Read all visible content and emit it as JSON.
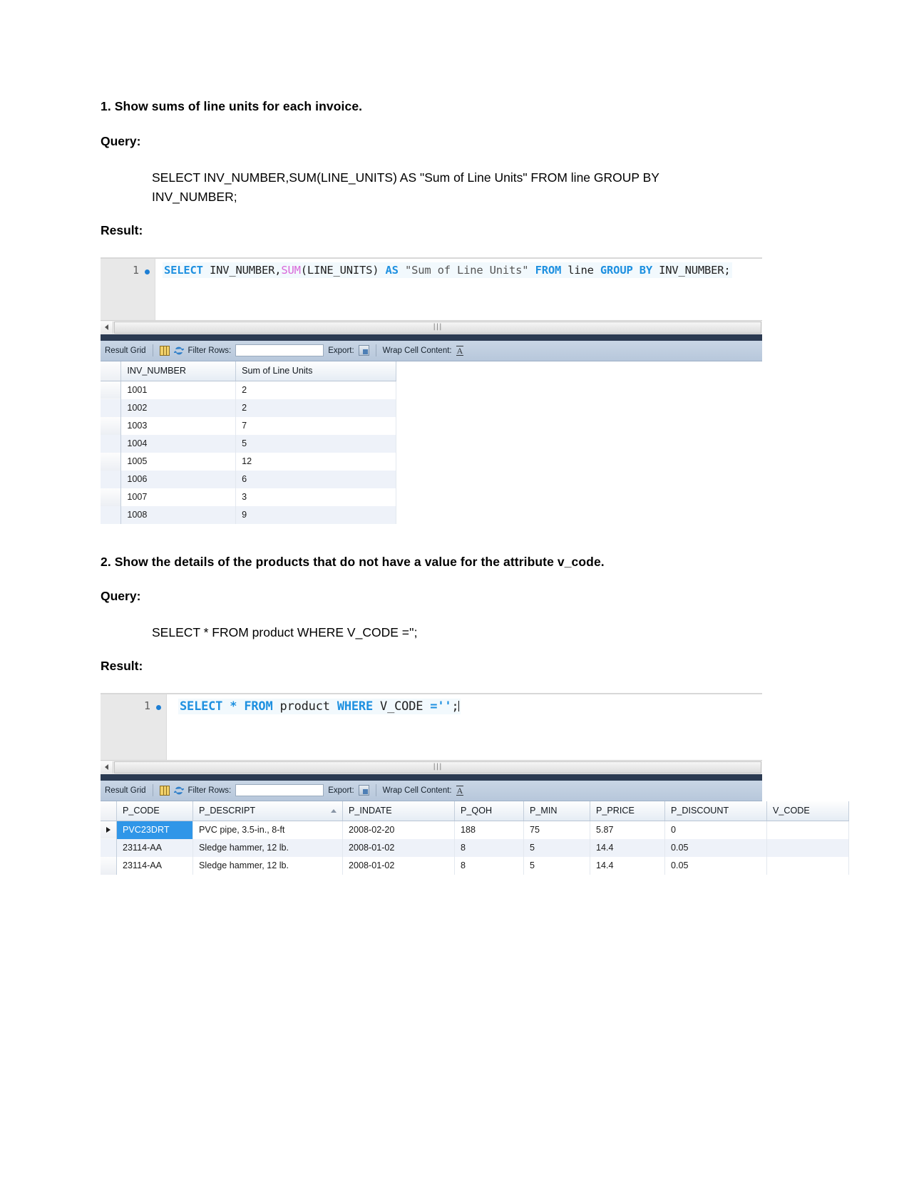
{
  "document": {
    "sections": [
      {
        "heading": "1. Show sums of line units for each invoice.",
        "query_label": "Query:",
        "query_text": "SELECT INV_NUMBER,SUM(LINE_UNITS) AS \"Sum of Line Units\" FROM line GROUP BY INV_NUMBER;",
        "result_label": "Result:"
      },
      {
        "heading": "2. Show the details of the products that do not have a value for the attribute v_code.",
        "query_label": "Query:",
        "query_text": "SELECT * FROM product WHERE V_CODE ='';",
        "result_label": "Result:"
      }
    ]
  },
  "workbench1": {
    "editor": {
      "line_number": "1",
      "tokens": [
        {
          "t": "SELECT",
          "c": "kw"
        },
        {
          "t": " ",
          "c": "id"
        },
        {
          "t": "INV_NUMBER,",
          "c": "id"
        },
        {
          "t": "SUM",
          "c": "fn"
        },
        {
          "t": "(LINE_UNITS)",
          "c": "id"
        },
        {
          "t": " ",
          "c": "id"
        },
        {
          "t": "AS",
          "c": "kw"
        },
        {
          "t": " ",
          "c": "id"
        },
        {
          "t": "\"Sum of Line Units\"",
          "c": "str"
        },
        {
          "t": " ",
          "c": "id"
        },
        {
          "t": "FROM",
          "c": "kw"
        },
        {
          "t": " line ",
          "c": "id"
        },
        {
          "t": "GROUP BY",
          "c": "kw"
        },
        {
          "t": " INV_NUMBER;",
          "c": "id"
        }
      ]
    },
    "toolbar": {
      "result_grid_label": "Result Grid",
      "filter_rows_label": "Filter Rows:",
      "filter_rows_value": "",
      "export_label": "Export:",
      "wrap_cell_content_label": "Wrap Cell Content:",
      "wrap_icon_glyph": "A"
    },
    "grid": {
      "columns": [
        "INV_NUMBER",
        "Sum of Line Units"
      ],
      "rows": [
        [
          "1001",
          "2"
        ],
        [
          "1002",
          "2"
        ],
        [
          "1003",
          "7"
        ],
        [
          "1004",
          "5"
        ],
        [
          "1005",
          "12"
        ],
        [
          "1006",
          "6"
        ],
        [
          "1007",
          "3"
        ],
        [
          "1008",
          "9"
        ]
      ]
    }
  },
  "workbench2": {
    "editor": {
      "line_number": "1",
      "tokens": [
        {
          "t": "SELECT",
          "c": "kw"
        },
        {
          "t": " ",
          "c": "id"
        },
        {
          "t": "*",
          "c": "kw"
        },
        {
          "t": " ",
          "c": "id"
        },
        {
          "t": "FROM",
          "c": "kw"
        },
        {
          "t": " product ",
          "c": "id"
        },
        {
          "t": "WHERE",
          "c": "kw"
        },
        {
          "t": " V_CODE ",
          "c": "id"
        },
        {
          "t": "=''",
          "c": "kw"
        },
        {
          "t": ";",
          "c": "id"
        }
      ]
    },
    "toolbar": {
      "result_grid_label": "Result Grid",
      "filter_rows_label": "Filter Rows:",
      "filter_rows_value": "",
      "export_label": "Export:",
      "wrap_cell_content_label": "Wrap Cell Content:",
      "wrap_icon_glyph": "A"
    },
    "grid": {
      "columns": [
        "P_CODE",
        "P_DESCRIPT",
        "P_INDATE",
        "P_QOH",
        "P_MIN",
        "P_PRICE",
        "P_DISCOUNT",
        "V_CODE"
      ],
      "sorted_column": "P_DESCRIPT",
      "sort_direction": "asc",
      "selected_cell": {
        "row": 0,
        "column": 0,
        "value": "PVC23DRT"
      },
      "rows": [
        [
          "PVC23DRT",
          "PVC pipe, 3.5-in., 8-ft",
          "2008-02-20",
          "188",
          "75",
          "5.87",
          "0",
          ""
        ],
        [
          "23114-AA",
          "Sledge hammer, 12 lb.",
          "2008-01-02",
          "8",
          "5",
          "14.4",
          "0.05",
          ""
        ],
        [
          "23114-AA",
          "Sledge hammer, 12 lb.",
          "2008-01-02",
          "8",
          "5",
          "14.4",
          "0.05",
          ""
        ]
      ]
    }
  },
  "colors": {
    "keyword": "#1e90e0",
    "function": "#d968d9",
    "selection": "#2f96e8",
    "toolbar": "#c9d6e5",
    "dark_band": "#2b3a51"
  }
}
